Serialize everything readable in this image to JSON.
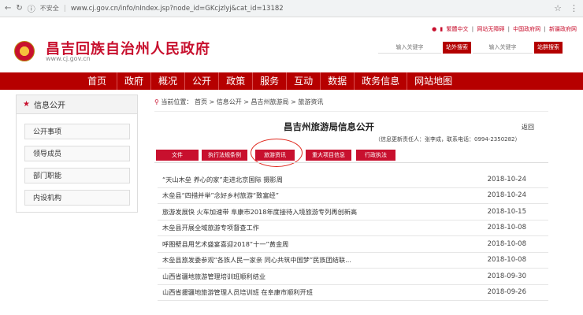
{
  "browser": {
    "back_icon": "arrow-left-icon",
    "reload_icon": "reload-icon",
    "security": "不安全",
    "url": "www.cj.gov.cn/info/nIndex.jsp?node_id=GKcjzlyj&cat_id=13182"
  },
  "header": {
    "site_title": "昌吉回族自治州人民政府",
    "site_url": "www.cj.gov.cn",
    "toplinks": [
      "繁體中文",
      "网站无障碍",
      "中国政府网",
      "新疆政府网"
    ],
    "search1_placeholder": "输入关键字",
    "search1_button": "站外搜索",
    "search2_placeholder": "输入关键字",
    "search2_button": "站群搜索"
  },
  "nav": [
    "首页",
    "政府",
    "概况",
    "公开",
    "政策",
    "服务",
    "互动",
    "数据",
    "政务信息",
    "网站地图"
  ],
  "sidebar": {
    "title": "信息公开",
    "items": [
      "公开事项",
      "领导成员",
      "部门职能",
      "内设机构"
    ]
  },
  "breadcrumb": {
    "prefix": "当前位置：",
    "parts": [
      "首页",
      "信息公开",
      "昌吉州旅游局",
      "旅游资讯"
    ],
    "separator": ">"
  },
  "content": {
    "title": "昌吉州旅游局信息公开",
    "back": "返回",
    "updater": "（信息更新责任人：张李成，联系电话：0994-2350282）",
    "tabs": [
      "文件",
      "执行法规条例",
      "旅游资讯",
      "重大项目信息",
      "行政执法"
    ],
    "rows": [
      {
        "title": "“天山木垒 养心的家”走进北京国际 摄影周",
        "date": "2018-10-24"
      },
      {
        "title": "木垒县“四措并举”念好乡村旅游“致富经”",
        "date": "2018-10-24"
      },
      {
        "title": "旅游发展快 火车加速带 阜康市2018年度接待入境旅游专列再创新高",
        "date": "2018-10-15"
      },
      {
        "title": "木垒县开展全域旅游专项督查工作",
        "date": "2018-10-08"
      },
      {
        "title": "呼图壁县用艺术盛宴喜迎2018“十一”黄金周",
        "date": "2018-10-08"
      },
      {
        "title": "木垒县旅发委参观“各族人民一家亲 同心共筑中国梦”民族团结联...",
        "date": "2018-10-08"
      },
      {
        "title": "山西省疆地旅游管理培训班顺利结业",
        "date": "2018-09-30"
      },
      {
        "title": "山西省援疆地旅游管理人员培训班 在阜康市顺利开班",
        "date": "2018-09-26"
      }
    ]
  }
}
